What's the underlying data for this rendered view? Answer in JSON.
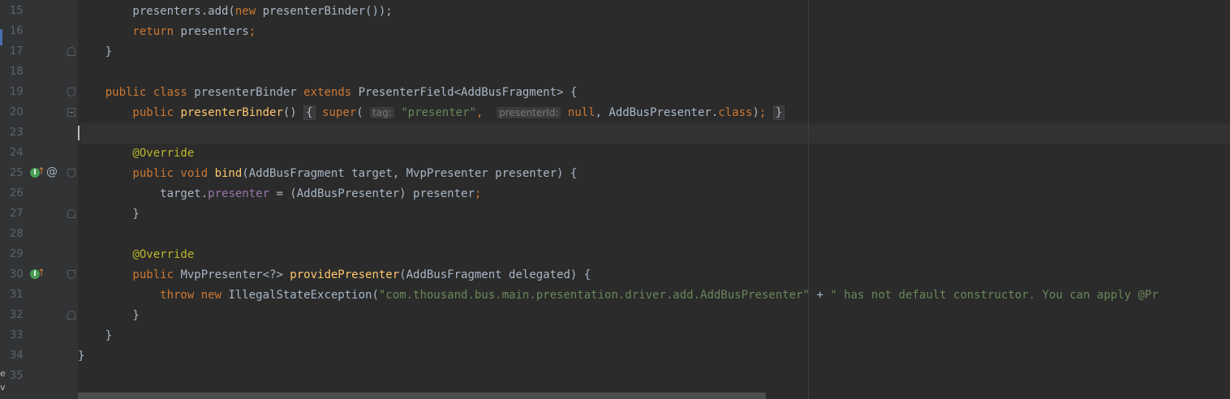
{
  "lines": [
    {
      "num": "15",
      "seg": [
        [
          "p",
          "        presenters.add("
        ],
        [
          "k",
          "new "
        ],
        [
          "p",
          "presenterBinder());"
        ]
      ]
    },
    {
      "num": "16",
      "seg": [
        [
          "k",
          "        return "
        ],
        [
          "p",
          "presenters"
        ],
        [
          "k",
          ";"
        ]
      ]
    },
    {
      "num": "17",
      "seg": [
        [
          "p",
          "    }"
        ]
      ]
    },
    {
      "num": "18",
      "seg": []
    },
    {
      "num": "19",
      "seg": [
        [
          "k",
          "    public class "
        ],
        [
          "p",
          "presenterBinder "
        ],
        [
          "k",
          "extends "
        ],
        [
          "p",
          "PresenterField<AddBusFragment> {"
        ]
      ]
    },
    {
      "num": "20",
      "seg": [
        [
          "k",
          "        public "
        ],
        [
          "f",
          "presenterBinder"
        ],
        [
          "p",
          "() "
        ],
        [
          "b",
          "{"
        ],
        [
          "p",
          " "
        ],
        [
          "k",
          "super"
        ],
        [
          "p",
          "( "
        ],
        [
          "h",
          "tag:"
        ],
        [
          "p",
          " "
        ],
        [
          "s",
          "\"presenter\""
        ],
        [
          "k",
          ", "
        ],
        [
          "p",
          " "
        ],
        [
          "h",
          "presenterId:"
        ],
        [
          "p",
          " "
        ],
        [
          "k",
          "null"
        ],
        [
          "p",
          ", AddBusPresenter."
        ],
        [
          "k",
          "class"
        ],
        [
          "p",
          ")"
        ],
        [
          "k",
          ";"
        ],
        [
          "p",
          " "
        ],
        [
          "b",
          "}"
        ]
      ]
    },
    {
      "num": "23",
      "seg": []
    },
    {
      "num": "24",
      "seg": [
        [
          "a",
          "        @Override"
        ]
      ]
    },
    {
      "num": "25",
      "seg": [
        [
          "k",
          "        public void "
        ],
        [
          "f",
          "bind"
        ],
        [
          "p",
          "(AddBusFragment target, MvpPresenter presenter) {"
        ]
      ]
    },
    {
      "num": "26",
      "seg": [
        [
          "p",
          "            target."
        ],
        [
          "d",
          "presenter"
        ],
        [
          "p",
          " = (AddBusPresenter) presenter"
        ],
        [
          "k",
          ";"
        ]
      ]
    },
    {
      "num": "27",
      "seg": [
        [
          "p",
          "        }"
        ]
      ]
    },
    {
      "num": "28",
      "seg": []
    },
    {
      "num": "29",
      "seg": [
        [
          "a",
          "        @Override"
        ]
      ]
    },
    {
      "num": "30",
      "seg": [
        [
          "k",
          "        public "
        ],
        [
          "p",
          "MvpPresenter<?> "
        ],
        [
          "f",
          "providePresenter"
        ],
        [
          "p",
          "(AddBusFragment delegated) {"
        ]
      ]
    },
    {
      "num": "31",
      "seg": [
        [
          "k",
          "            throw new "
        ],
        [
          "p",
          "IllegalStateException("
        ],
        [
          "s",
          "\"com.thousand.bus.main.presentation.driver.add.AddBusPresenter\""
        ],
        [
          "p",
          " + "
        ],
        [
          "s",
          "\" has not default constructor. You can apply @Pr"
        ]
      ]
    },
    {
      "num": "32",
      "seg": [
        [
          "p",
          "        }"
        ]
      ]
    },
    {
      "num": "33",
      "seg": [
        [
          "p",
          "    }"
        ]
      ]
    },
    {
      "num": "34",
      "seg": [
        [
          "p",
          "}"
        ]
      ]
    },
    {
      "num": "35",
      "seg": []
    }
  ],
  "gutter_icons": {
    "line25_override": "I",
    "line25_at": "@",
    "line30_override": "I",
    "arrow": "↑"
  },
  "side_fragment": "e\nv",
  "colors": {
    "background": "#2b2b2b",
    "gutter": "#313335",
    "keyword": "#cc7832",
    "method": "#ffc66d",
    "string": "#6a8759",
    "annotation": "#bbb529",
    "field": "#9876aa",
    "text": "#a9b7c6"
  }
}
